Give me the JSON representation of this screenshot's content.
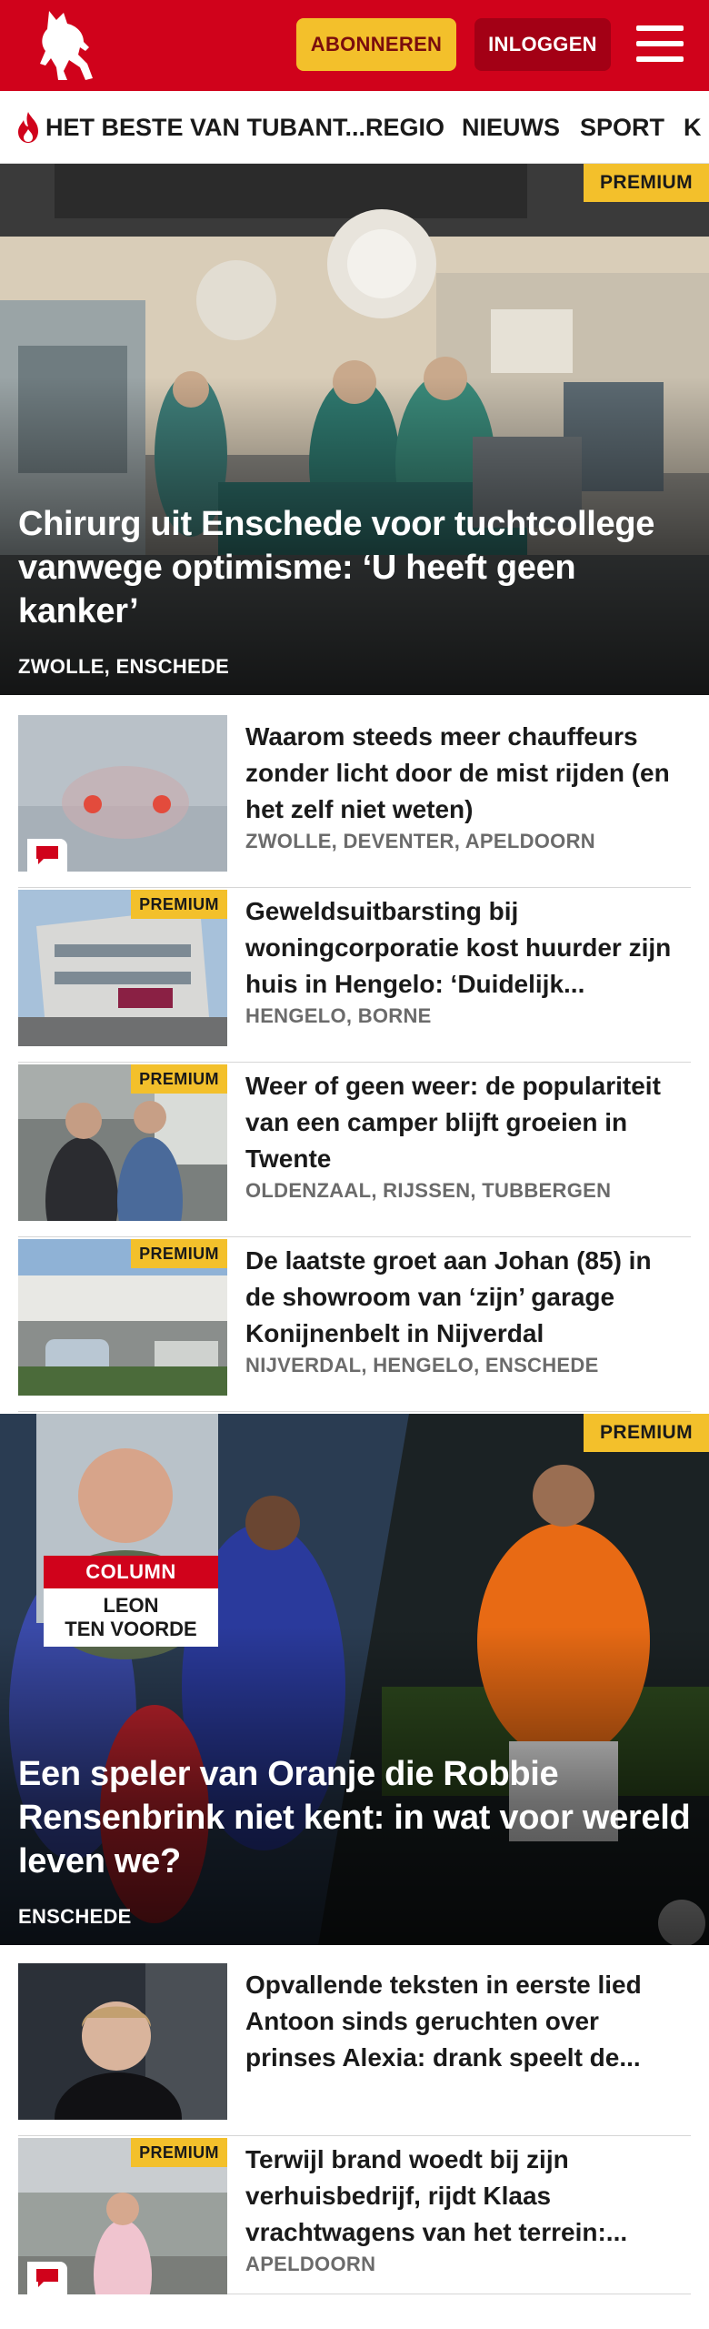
{
  "header": {
    "subscribe_label": "ABONNEREN",
    "login_label": "INLOGGEN",
    "brand_color": "#d0021b",
    "logo_icon": "horse-logo-icon",
    "menu_icon": "hamburger-menu-icon"
  },
  "nav": {
    "items": [
      {
        "label": "HET BESTE VAN TUBANT..."
      },
      {
        "label": "REGIO"
      },
      {
        "label": "NIEUWS"
      },
      {
        "label": "SPORT"
      },
      {
        "label": "K"
      }
    ]
  },
  "hero1": {
    "badge": "PREMIUM",
    "title": "Chirurg uit Enschede voor tuchtcolle­ge vanwege optimisme: ‘U heeft geen kanker’",
    "location": "ZWOLLE, ENSCHEDE"
  },
  "articles1": [
    {
      "title": "Waarom steeds meer chauffeurs zonder licht door de mist rijden (en het zelf niet weten)",
      "location": "ZWOLLE, DEVENTER, APELDOORN",
      "badge": ""
    },
    {
      "title": "Geweldsuitbarsting bij woningcorporatie kost huurder zijn huis in Hengelo: ‘Duidelijk...",
      "location": "HENGELO, BORNE",
      "badge": "PREMIUM"
    },
    {
      "title": "Weer of geen weer: de populari­teit van een camper blijft groeien in Twente",
      "location": "OLDENZAAL, RIJSSEN, TUBBERGEN",
      "badge": "PREMIUM"
    },
    {
      "title": "De laatste groet aan Johan (85) in de showroom van ‘zijn’ garage Konijnenbelt in Nijverdal",
      "location": "NIJVERDAL, HENGELO, ENSCHEDE",
      "badge": "PREMIUM"
    }
  ],
  "hero2": {
    "badge": "PREMIUM",
    "column_label": "COLUMN",
    "author_line1": "LEON",
    "author_line2": "TEN VOORDE",
    "title": "Een speler van Oranje die Robbie Rensenbrink niet kent: in wat voor wereld leven we?",
    "location": "ENSCHEDE"
  },
  "articles2": [
    {
      "title": "Opvallende teksten in eerste lied Antoon sinds geruchten over prinses Alexia: drank speelt de...",
      "location": "",
      "badge": ""
    },
    {
      "title": "Terwijl brand woedt bij zijn verhuisbedrijf, rijdt Klaas vrachtwagens van het terrein:...",
      "location": "APELDOORN",
      "badge": "PREMIUM"
    }
  ]
}
